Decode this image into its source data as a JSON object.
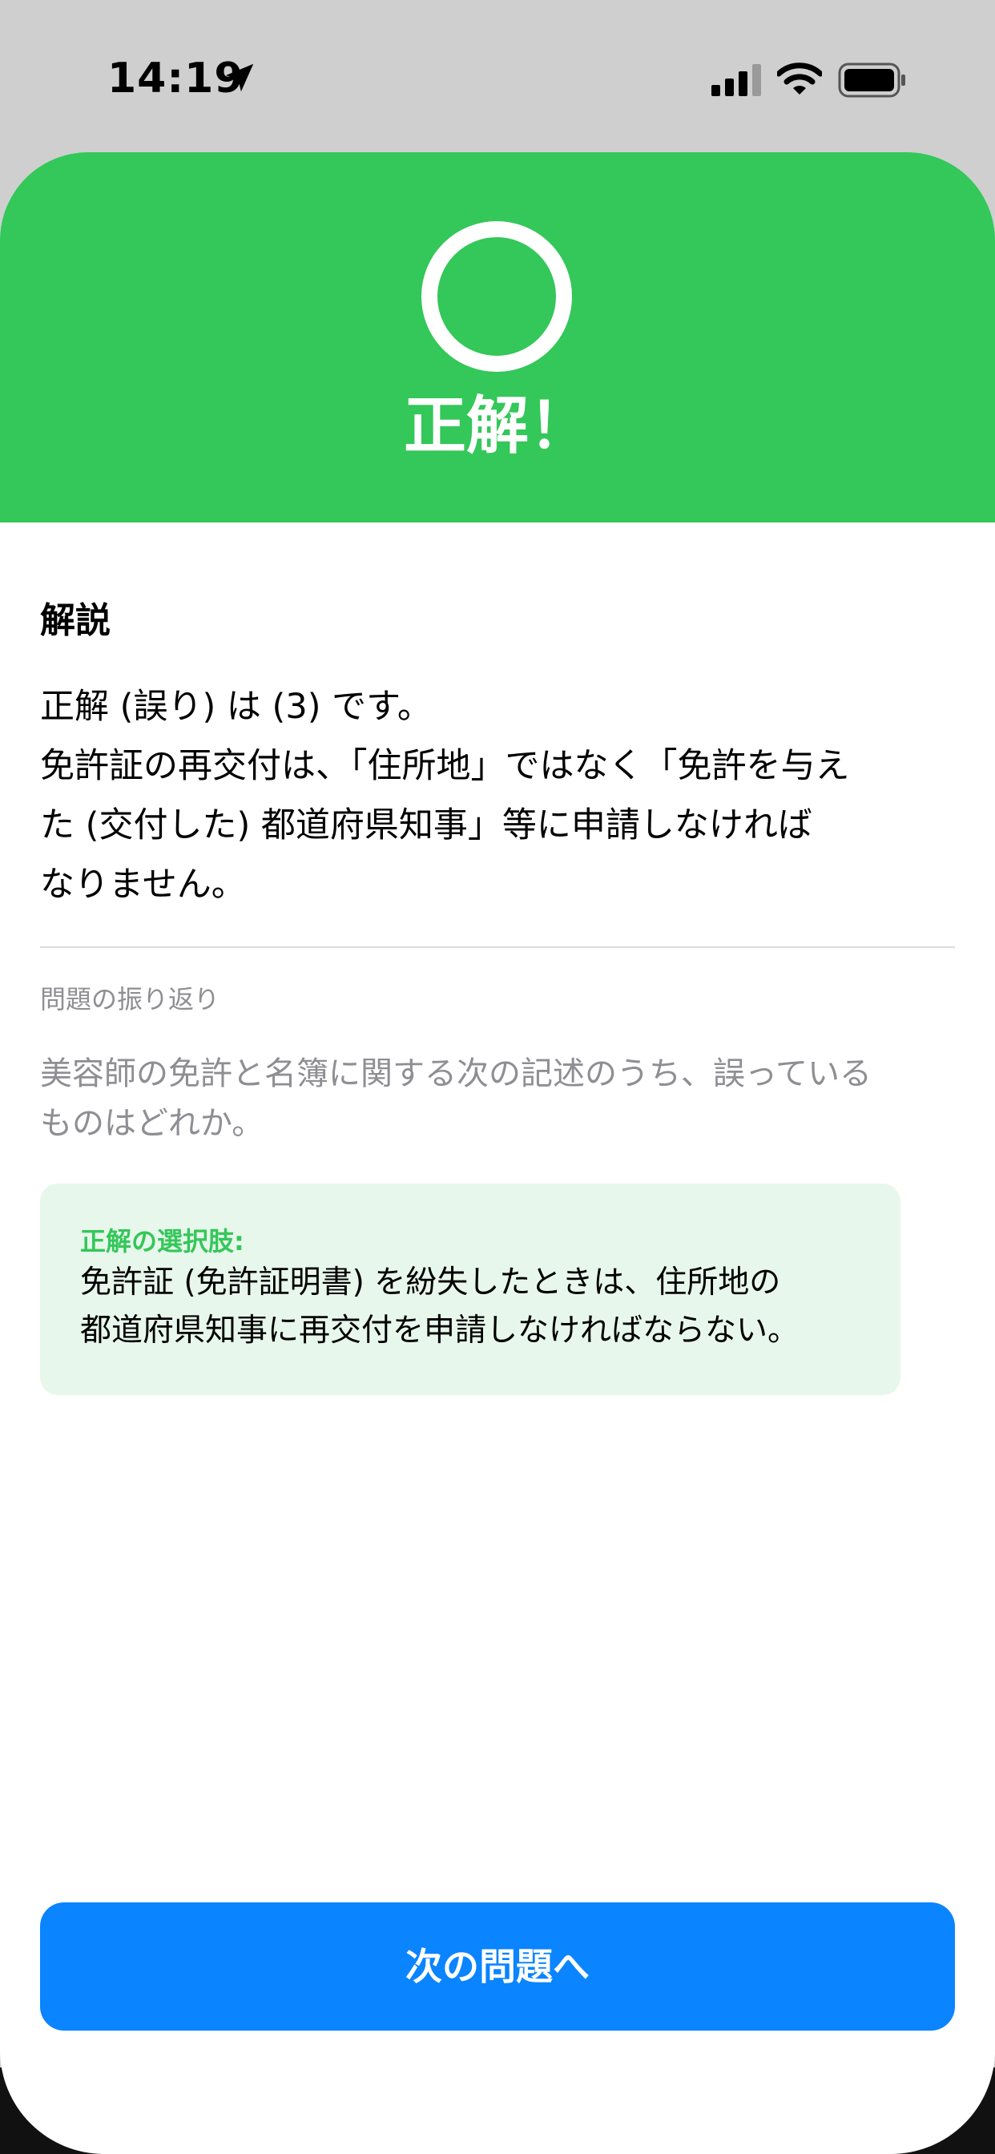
{
  "status_bar": {
    "time": "14:19"
  },
  "result": {
    "title": "正解！"
  },
  "explanation": {
    "heading": "解説",
    "lines": [
      "正解 (誤り) は (3) です。",
      "免許証の再交付は、「住所地」ではなく「免許を与え",
      "た (交付した) 都道府県知事」等に申請しなければ",
      "なりません。"
    ]
  },
  "review": {
    "label": "問題の振り返り",
    "question_lines": [
      "美容師の免許と名簿に関する次の記述のうち、誤っている",
      "ものはどれか。"
    ],
    "answer_label": "正解の選択肢:",
    "answer_lines": [
      "免許証 (免許証明書) を紛失したときは、住所地の",
      "都道府県知事に再交付を申請しなければならない。"
    ]
  },
  "next_button": {
    "label": "次の問題へ"
  },
  "colors": {
    "success": "#34c759",
    "primary": "#0a84ff",
    "answer_bg": "#e8f7ec",
    "muted": "#8e8e93"
  },
  "icons": {
    "location": "location-arrow-icon",
    "signal": "cellular-signal-icon",
    "wifi": "wifi-icon",
    "battery": "battery-icon",
    "result": "circle-correct-icon"
  }
}
